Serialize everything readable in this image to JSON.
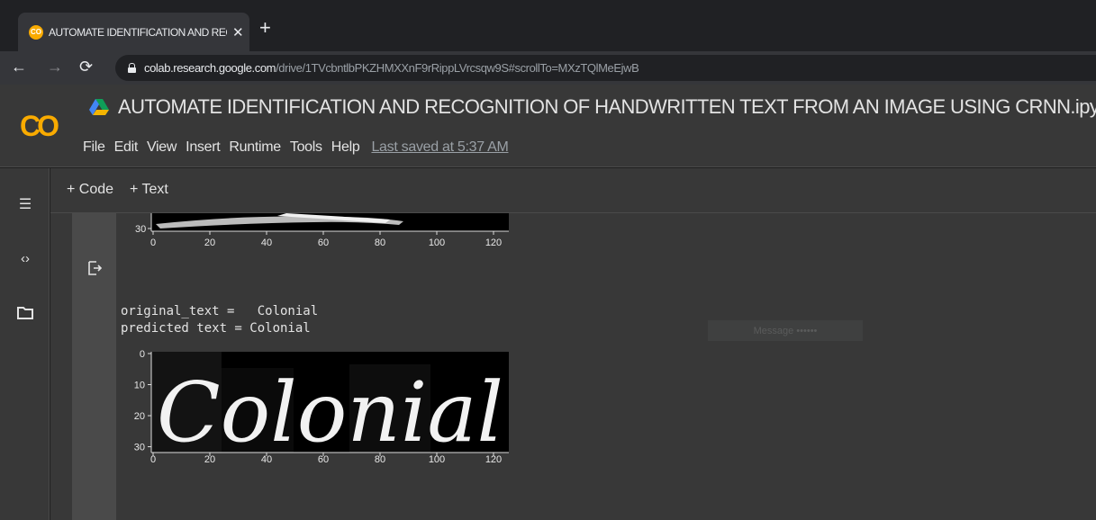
{
  "browser": {
    "tab_title": "AUTOMATE IDENTIFICATION AND RECOGNITION OF HANDWRITTEN TEXT FROM AN  IMAGE USING CRNN.ipynb",
    "tab_favicon_text": "CO",
    "url_host": "colab.research.google.com",
    "url_path": "/drive/1TVcbntlbPKZHMXXnF9rRippLVrcsqw9S#scrollTo=MXzTQlMeEjwB"
  },
  "colab": {
    "logo": "CO",
    "notebook_title": "AUTOMATE IDENTIFICATION AND RECOGNITION OF HANDWRITTEN TEXT FROM AN  IMAGE USING CRNN.ipynb",
    "menu": [
      "File",
      "Edit",
      "View",
      "Insert",
      "Runtime",
      "Tools",
      "Help"
    ],
    "last_saved": "Last saved at 5:37 AM",
    "add_code": "+ Code",
    "add_text": "+ Text"
  },
  "output": {
    "line1": "original_text =   Colonial",
    "line2": "predicted text = Colonial",
    "faint_box": "Message ••••••"
  },
  "plot_top": {
    "x_ticks": [
      "0",
      "20",
      "40",
      "60",
      "80",
      "100",
      "120"
    ],
    "y_ticks": [
      "30"
    ]
  },
  "plot_bottom": {
    "x_ticks": [
      "0",
      "20",
      "40",
      "60",
      "80",
      "100",
      "120"
    ],
    "y_ticks": [
      "0",
      "10",
      "20",
      "30"
    ],
    "image_word": "Colonial"
  },
  "colors": {
    "accent": "#f9ab00",
    "panel": "#383838",
    "gutter": "#4a4a4a"
  }
}
